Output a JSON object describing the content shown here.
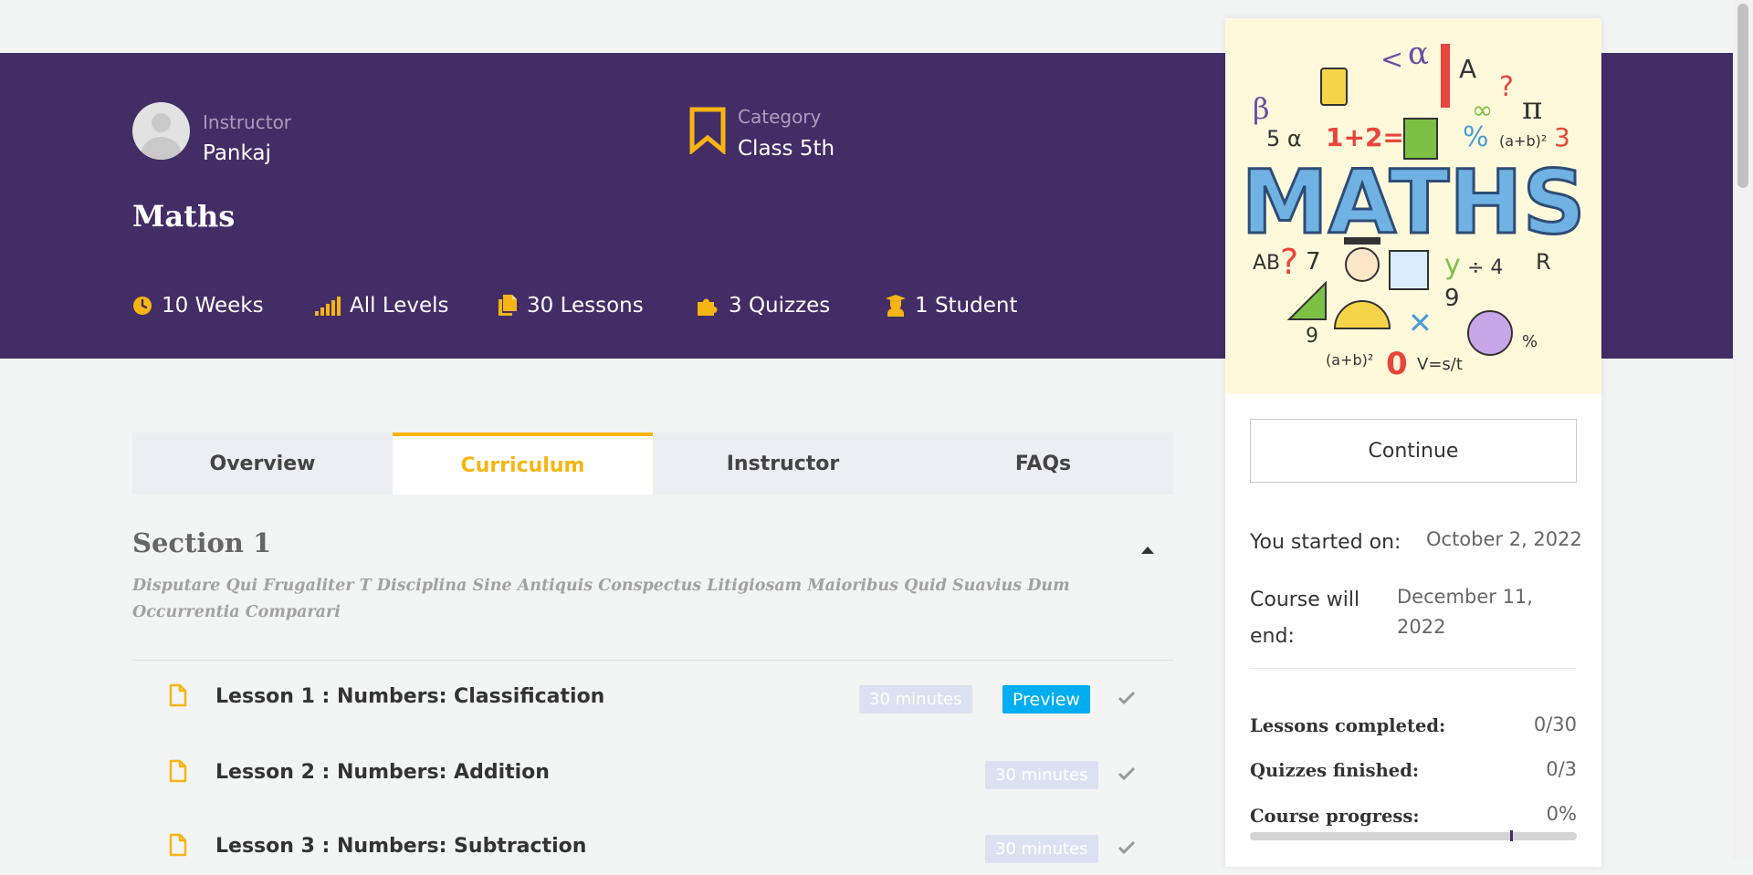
{
  "course": {
    "title": "Maths",
    "instructor_label": "Instructor",
    "instructor_name": "Pankaj",
    "category_label": "Category",
    "category_value": "Class 5th"
  },
  "stats": [
    {
      "icon": "clock-icon",
      "text": "10 Weeks"
    },
    {
      "icon": "signal-bars-icon",
      "text": "All Levels"
    },
    {
      "icon": "files-icon",
      "text": "30 Lessons"
    },
    {
      "icon": "puzzle-icon",
      "text": "3 Quizzes"
    },
    {
      "icon": "student-icon",
      "text": "1 Student"
    }
  ],
  "tabs": [
    {
      "label": "Overview",
      "active": false
    },
    {
      "label": "Curriculum",
      "active": true
    },
    {
      "label": "Instructor",
      "active": false
    },
    {
      "label": "FAQs",
      "active": false
    }
  ],
  "section": {
    "title": "Section 1",
    "description": "Disputare Qui Frugaliter T Disciplina Sine Antiquis Conspectus Litigiosam Maioribus Quid Suavius Dum Occurrentia Comparari"
  },
  "lessons": [
    {
      "title": "Lesson 1 : Numbers: Classification",
      "duration": "30 minutes",
      "preview": "Preview"
    },
    {
      "title": "Lesson 2 : Numbers: Addition",
      "duration": "30 minutes"
    },
    {
      "title": "Lesson 3 : Numbers: Subtraction",
      "duration": "30 minutes"
    }
  ],
  "sidebar": {
    "thumbnail_text": "MATHS",
    "continue_label": "Continue",
    "started_label": "You started on:",
    "started_value": "October 2, 2022",
    "end_label_1": "Course will",
    "end_label_2": "end:",
    "end_value_1": "December 11,",
    "end_value_2": "2022",
    "lessons_completed_label": "Lessons completed:",
    "lessons_completed_value": "0/30",
    "quizzes_finished_label": "Quizzes finished:",
    "quizzes_finished_value": "0/3",
    "course_progress_label": "Course progress:",
    "course_progress_value": "0%"
  },
  "colors": {
    "hero_bg": "#432d66",
    "accent": "#f7b514",
    "preview": "#00adf1"
  }
}
